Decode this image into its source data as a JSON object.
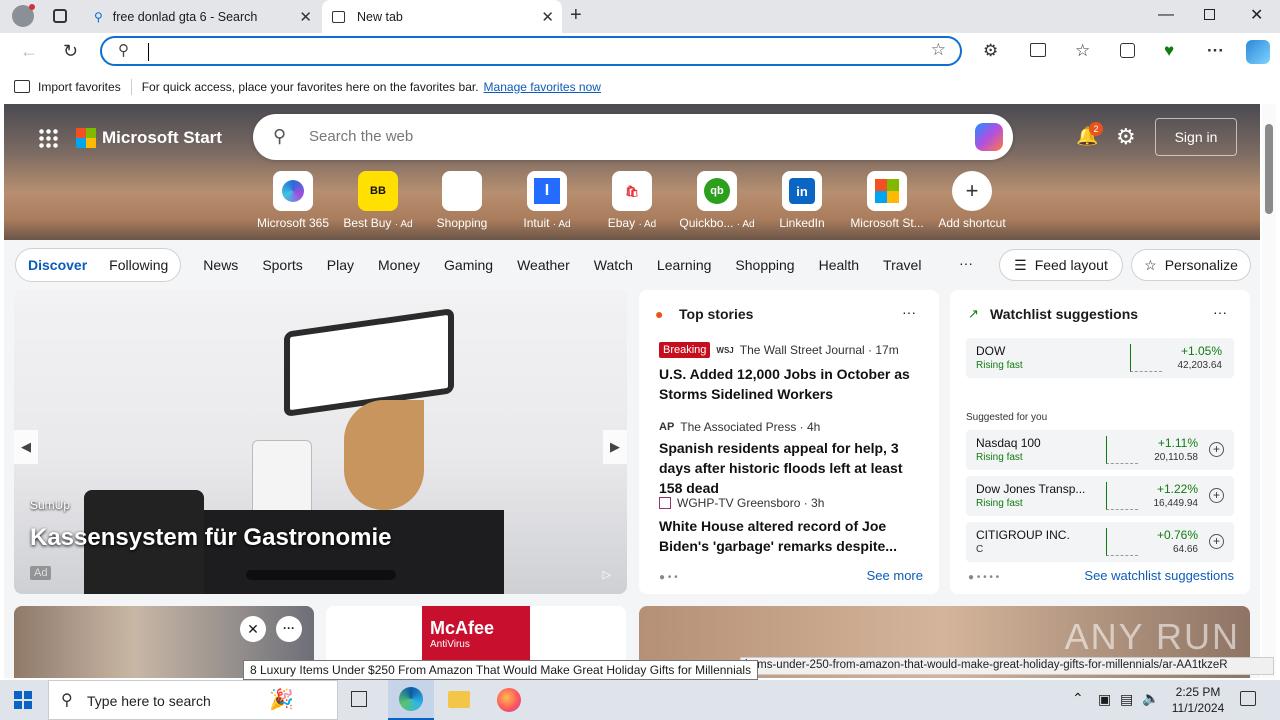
{
  "browser": {
    "tabs": [
      {
        "title": "free donlad gta 6 - Search"
      },
      {
        "title": "New tab"
      }
    ],
    "address_value": "",
    "favorites_bar": {
      "import_label": "Import favorites",
      "message": "For quick access, place your favorites here on the favorites bar.",
      "manage_link": "Manage favorites now"
    }
  },
  "msn": {
    "brand": "Microsoft Start",
    "search_placeholder": "Search the web",
    "notif_count": "2",
    "signin_label": "Sign in",
    "shortcuts": [
      {
        "label": "Microsoft 365",
        "ad": ""
      },
      {
        "label": "Best Buy",
        "ad": "· Ad"
      },
      {
        "label": "Shopping",
        "ad": ""
      },
      {
        "label": "Intuit",
        "ad": "· Ad"
      },
      {
        "label": "Ebay",
        "ad": "· Ad"
      },
      {
        "label": "Quickbo...",
        "ad": "· Ad"
      },
      {
        "label": "LinkedIn",
        "ad": ""
      },
      {
        "label": "Microsoft St...",
        "ad": ""
      },
      {
        "label": "Add shortcut",
        "ad": ""
      }
    ],
    "nav": {
      "discover": "Discover",
      "following": "Following",
      "items": [
        "News",
        "Sports",
        "Play",
        "Money",
        "Gaming",
        "Weather",
        "Watch",
        "Learning",
        "Shopping",
        "Health",
        "Travel"
      ],
      "more": "···",
      "feed_layout": "Feed layout",
      "personalize": "Personalize"
    },
    "hero_card": {
      "sponsor": "SumUp",
      "title": "Kassensystem für Gastronomie",
      "ad_badge": "Ad"
    },
    "top_stories": {
      "heading": "Top stories",
      "more": "···",
      "stories": [
        {
          "badge": "Breaking",
          "source": "The Wall Street Journal · 17m",
          "title": "U.S. Added 12,000 Jobs in October as Storms Sidelined Workers"
        },
        {
          "badge": "",
          "source": "The Associated Press · 4h",
          "title": "Spanish residents appeal for help, 3 days after historic floods left at least 158 dead"
        },
        {
          "badge": "",
          "source": "WGHP-TV Greensboro · 3h",
          "title": "White House altered record of Joe Biden's 'garbage' remarks despite..."
        }
      ],
      "see_more": "See more"
    },
    "watchlist": {
      "heading": "Watchlist suggestions",
      "more": "···",
      "main": {
        "name": "DOW",
        "status": "Rising fast",
        "change": "+1.05%",
        "value": "42,203.64"
      },
      "suggested_label": "Suggested for you",
      "items": [
        {
          "name": "Nasdaq 100",
          "status": "Rising fast",
          "change": "+1.11%",
          "value": "20,110.58"
        },
        {
          "name": "Dow Jones Transp...",
          "status": "Rising fast",
          "change": "+1.22%",
          "value": "16,449.94"
        },
        {
          "name": "CITIGROUP INC.",
          "status": "C",
          "change": "+0.76%",
          "value": "64.66"
        }
      ],
      "see_link": "See watchlist suggestions"
    },
    "mcafee": "McAfee",
    "mcafee_sub": "AntiVirus"
  },
  "tooltip": "8 Luxury Items Under $250 From Amazon That Would Make Great Holiday Gifts for Millennials",
  "status_url": "items-under-250-from-amazon-that-would-make-great-holiday-gifts-for-millennials/ar-AA1tkzeR",
  "watermark": "ANY RUN",
  "taskbar": {
    "search_placeholder": "Type here to search",
    "time": "2:25 PM",
    "date": "11/1/2024"
  }
}
